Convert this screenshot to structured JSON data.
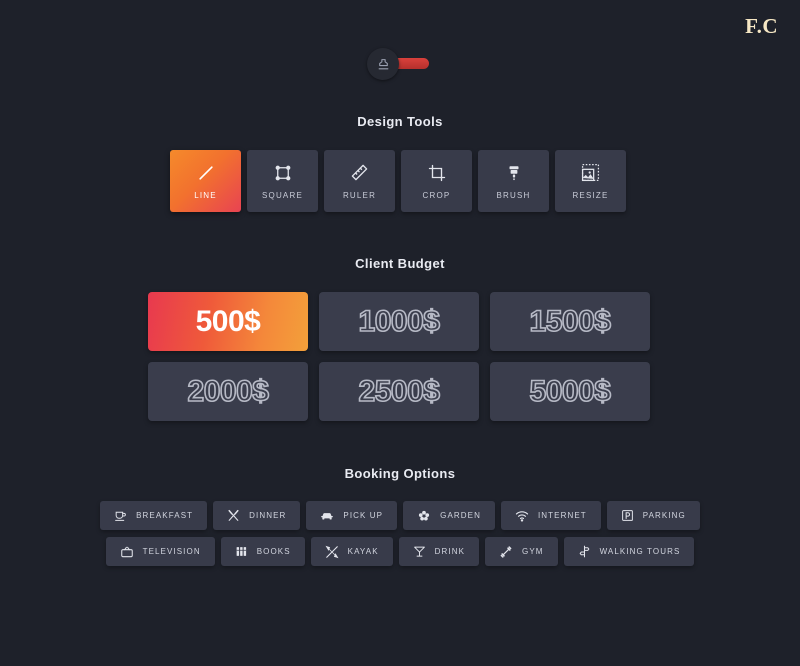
{
  "brand": {
    "logo": "F.C"
  },
  "toggle": {
    "name": "theme-toggle",
    "state": "on",
    "track_color": "#c9383a",
    "knob_color": "#262932",
    "knob_icon": "stamp-icon"
  },
  "theme": {
    "background": "#1e212a",
    "card": "#383b4a",
    "card_alt": "#3a3d4c",
    "accent_start": "#e8394f",
    "accent_end": "#f3a03a",
    "text": "#e9ebf2",
    "muted_text": "#c9ccd8",
    "logo_color": "#f6e7c4"
  },
  "sections": {
    "design_tools": {
      "title": "Design Tools",
      "items": [
        {
          "label": "LINE",
          "icon": "diagonal-line-icon",
          "selected": true
        },
        {
          "label": "SQUARE",
          "icon": "square-nodes-icon",
          "selected": false
        },
        {
          "label": "RULER",
          "icon": "ruler-icon",
          "selected": false
        },
        {
          "label": "CROP",
          "icon": "crop-icon",
          "selected": false
        },
        {
          "label": "BRUSH",
          "icon": "brush-icon",
          "selected": false
        },
        {
          "label": "RESIZE",
          "icon": "resize-image-icon",
          "selected": false
        }
      ]
    },
    "client_budget": {
      "title": "Client Budget",
      "items": [
        {
          "label": "500$",
          "selected": true
        },
        {
          "label": "1000$",
          "selected": false
        },
        {
          "label": "1500$",
          "selected": false
        },
        {
          "label": "2000$",
          "selected": false
        },
        {
          "label": "2500$",
          "selected": false
        },
        {
          "label": "5000$",
          "selected": false
        }
      ]
    },
    "booking_options": {
      "title": "Booking Options",
      "rows": [
        [
          {
            "label": "BREAKFAST",
            "icon": "coffee-cup-icon"
          },
          {
            "label": "DINNER",
            "icon": "fork-knife-icon"
          },
          {
            "label": "PICK UP",
            "icon": "car-icon"
          },
          {
            "label": "GARDEN",
            "icon": "flower-icon"
          },
          {
            "label": "INTERNET",
            "icon": "wifi-icon"
          },
          {
            "label": "PARKING",
            "icon": "parking-icon"
          }
        ],
        [
          {
            "label": "TELEVISION",
            "icon": "television-icon"
          },
          {
            "label": "BOOKS",
            "icon": "books-icon"
          },
          {
            "label": "KAYAK",
            "icon": "kayak-icon"
          },
          {
            "label": "DRINK",
            "icon": "cocktail-icon"
          },
          {
            "label": "GYM",
            "icon": "dumbbell-icon"
          },
          {
            "label": "WALKING TOURS",
            "icon": "signpost-icon"
          }
        ]
      ]
    }
  }
}
